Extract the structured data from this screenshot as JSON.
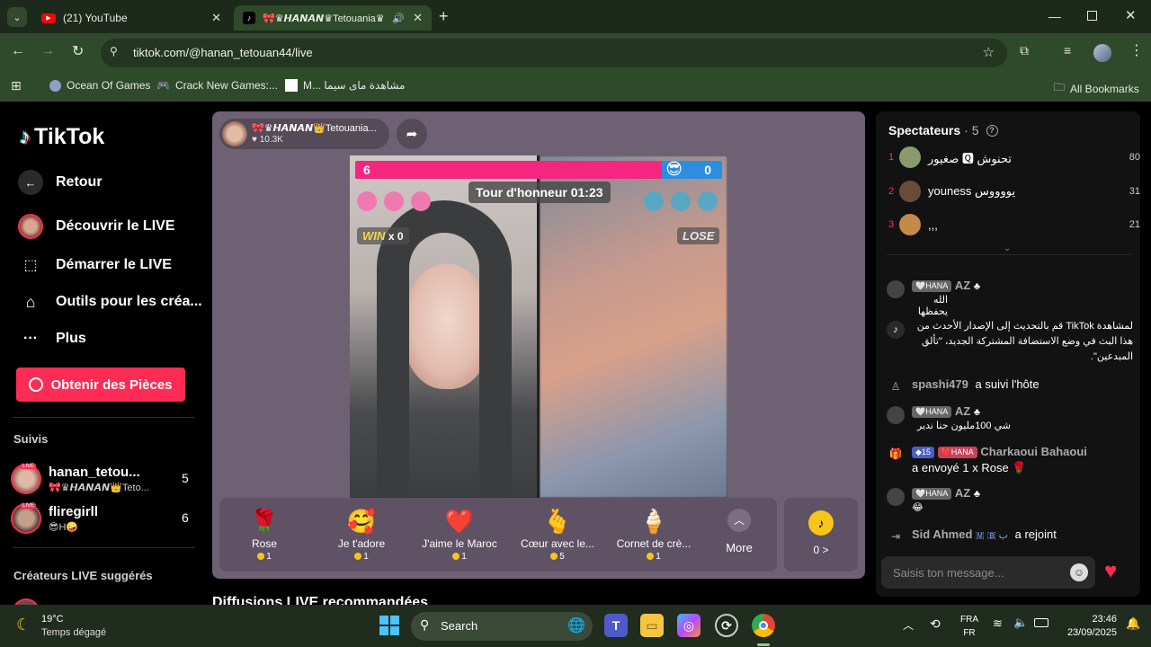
{
  "browser": {
    "tabs": [
      {
        "title": "(21) YouTube"
      },
      {
        "title": "🎀♛𝙃𝘼𝙉𝘼𝙉♛Tetouania♛"
      }
    ],
    "new_tab": "+",
    "url": "tiktok.com/@hanan_tetouan44/live",
    "bookmarks": [
      {
        "label": "Ocean Of Games"
      },
      {
        "label": "Crack New Games:..."
      },
      {
        "label": "M... مشاهدة ماى سيما"
      }
    ],
    "all_bookmarks": "All Bookmarks"
  },
  "tiktok": {
    "logo": "TikTok",
    "nav": [
      {
        "label": "Retour"
      },
      {
        "label": "Découvrir le LIVE"
      },
      {
        "label": "Démarrer le LIVE"
      },
      {
        "label": "Outils pour les créa..."
      },
      {
        "label": "Plus"
      }
    ],
    "coins_button": "Obtenir des Pièces",
    "following_heading": "Suivis",
    "following": [
      {
        "name": "hanan_tetou...",
        "sub": "🎀♛𝙃𝘼𝙉𝘼𝙉👑Teto...",
        "count": "5"
      },
      {
        "name": "fliregirll",
        "sub": "😎H🤪",
        "count": "6"
      }
    ],
    "suggested_heading": "Créateurs LIVE suggérés",
    "recommended_heading": "Diffusions LIVE recommandées"
  },
  "live": {
    "host_name": "🎀♛𝙃𝘼𝙉𝘼𝙉👑Tetouania...",
    "likes": "10.3K",
    "battle": {
      "left_score": "6",
      "right_score": "0",
      "left_share": 0.835,
      "timer": "Tour d'honneur 01:23",
      "win_label": "WIN",
      "win_count": "x 0",
      "lose_label": "LOSE"
    },
    "gifts": [
      {
        "name": "Rose",
        "price": "1",
        "icon": "🌹"
      },
      {
        "name": "Je t'adore",
        "price": "1",
        "icon": "🥰"
      },
      {
        "name": "J'aime le Maroc",
        "price": "1",
        "icon": "❤️"
      },
      {
        "name": "Cœur avec le...",
        "price": "5",
        "icon": "🫰"
      },
      {
        "name": "Cornet de crè...",
        "price": "1",
        "icon": "🍦"
      }
    ],
    "more": "More",
    "balance": "0 >"
  },
  "viewers": {
    "title": "Spectateurs",
    "count": "· 5",
    "list": [
      {
        "rank": "1",
        "name": "صغيور 🆀 تحنوش",
        "score": "80"
      },
      {
        "rank": "2",
        "name": "youness يووووس",
        "score": "31"
      },
      {
        "rank": "3",
        "name": ",,,",
        "score": "21"
      }
    ]
  },
  "chat": {
    "messages": [
      {
        "badge": "🤍HANA",
        "user": "AZ",
        "extra": "♣",
        "text": "الله يحفظها"
      },
      {
        "badge": "",
        "user": "",
        "extra": "",
        "text": "لمشاهدة TikTok قم بالتحديث إلى الإصدار الأحدث من هذا البث في وضع الاستضافة المشتركة الجديد، \"تألق المبدعين\"."
      },
      {
        "badge": "",
        "user": "spashi479",
        "extra": "",
        "text": "a suivi l'hôte"
      },
      {
        "badge": "🤍HANA",
        "user": "AZ",
        "extra": "♣",
        "text": "شي 100مليون حنا ندير"
      },
      {
        "badge": "❤️HANA",
        "badge2": "◆15",
        "user": "Charkaoui Bahaoui",
        "extra": "",
        "text": "a envoyé 1 x Rose 🌹"
      },
      {
        "badge": "🤍HANA",
        "user": "AZ",
        "extra": "♣",
        "text": "😂"
      },
      {
        "badge": "",
        "user": "Sid Ahmed",
        "extra": "🇲 🇧 ب",
        "text": "a rejoint"
      }
    ],
    "input_placeholder": "Saisis ton message..."
  },
  "taskbar": {
    "weather_temp": "19°C",
    "weather_desc": "Temps dégagé",
    "search": "Search",
    "lang_top": "FRA",
    "lang_bottom": "FR",
    "time": "23:46",
    "date": "23/09/2025"
  }
}
